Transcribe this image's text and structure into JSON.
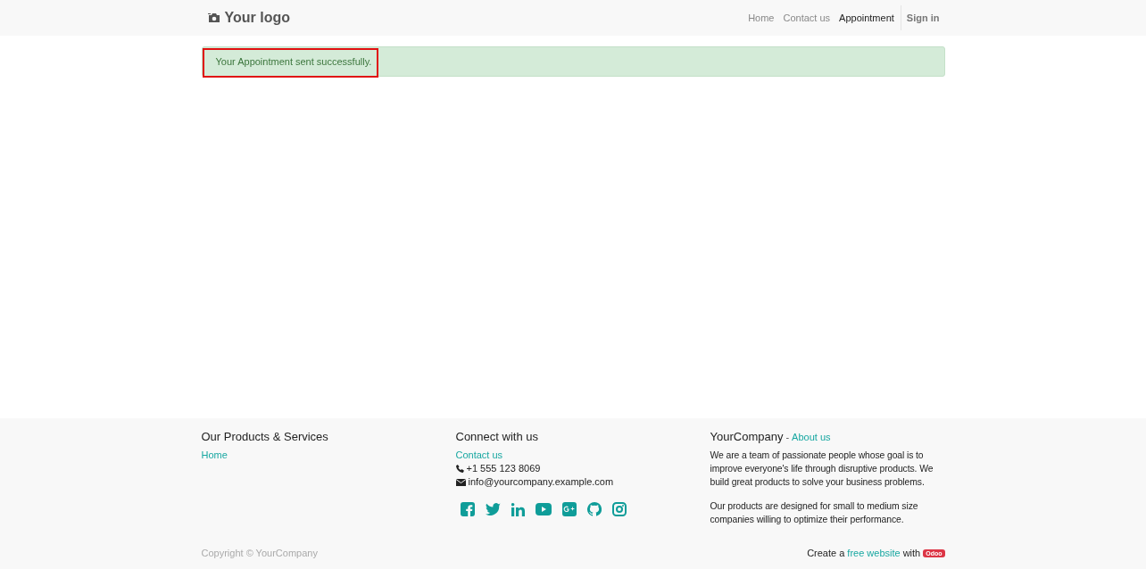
{
  "header": {
    "logo": "Your logo",
    "nav": [
      {
        "label": "Home",
        "selected": false
      },
      {
        "label": "Contact us",
        "selected": false
      },
      {
        "label": "Appointment",
        "selected": true
      }
    ],
    "sign_in": "Sign in"
  },
  "alert": {
    "message": "Your Appointment sent successfully.",
    "highlighted": true
  },
  "footer": {
    "columns": [
      {
        "kind": "links",
        "title": "Our Products & Services",
        "links": [
          "Home"
        ]
      },
      {
        "kind": "contact",
        "title": "Connect with us",
        "links": [
          "Contact us"
        ],
        "phone": "+1 555 123 8069",
        "email": "info@yourcompany.example.com",
        "socials": [
          {
            "kind": "facebook"
          },
          {
            "kind": "twitter"
          },
          {
            "kind": "linkedin"
          },
          {
            "kind": "youtube"
          },
          {
            "kind": "google-plus"
          },
          {
            "kind": "github"
          },
          {
            "kind": "instagram"
          }
        ]
      },
      {
        "kind": "about",
        "title": "YourCompany",
        "separator": "-",
        "link": "About us",
        "paragraphs": [
          "We are a team of passionate people whose goal is to improve everyone's life through disruptive products. We build great products to solve your business problems.",
          "Our products are designed for small to medium size companies willing to optimize their performance."
        ]
      }
    ],
    "copyright": "Copyright © YourCompany",
    "credit": {
      "before": "Create a",
      "link": "free website",
      "after": "with",
      "badge": "Odoo"
    }
  }
}
